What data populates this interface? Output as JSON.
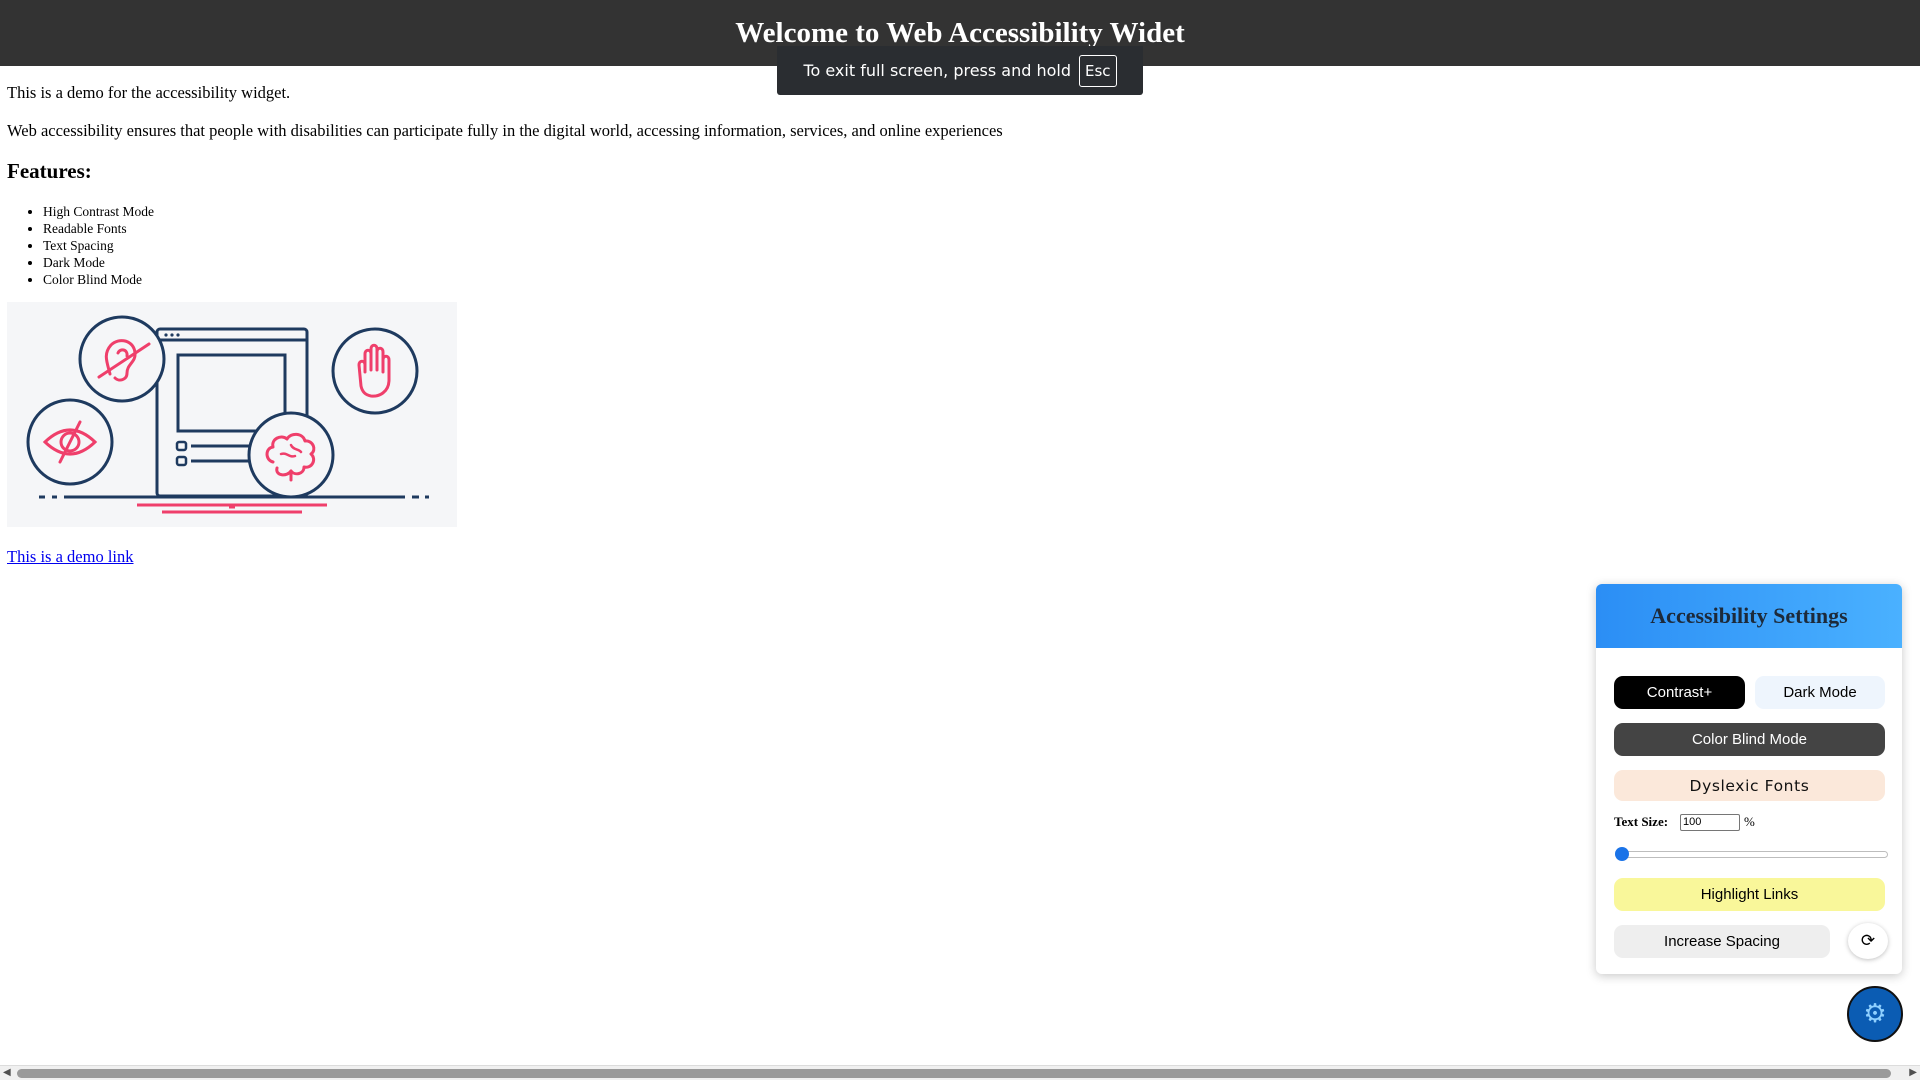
{
  "header": {
    "title": "Welcome to Web Accessibility Widet"
  },
  "fullscreen_notice": {
    "text": "To exit full screen, press and hold",
    "key": "Esc"
  },
  "main": {
    "intro": "This is a demo for the accessibility widget.",
    "description": "Web accessibility ensures that people with disabilities can participate fully in the digital world, accessing information, services, and online experiences",
    "features_heading": "Features:",
    "features": [
      "High Contrast Mode",
      "Readable Fonts",
      "Text Spacing",
      "Dark Mode",
      "Color Blind Mode"
    ],
    "illustration_icons": [
      "hearing-impaired-icon",
      "hand-icon",
      "visually-impaired-icon",
      "brain-icon",
      "browser-window-icon"
    ],
    "demo_link": "This is a demo link"
  },
  "panel": {
    "title": "Accessibility Settings",
    "contrast_label": "Contrast+",
    "dark_mode_label": "Dark Mode",
    "color_blind_label": "Color Blind Mode",
    "dyslexic_label": "Dyslexic Fonts",
    "text_size_label": "Text Size:",
    "text_size_value": "100",
    "text_size_unit": "%",
    "text_size_slider_fraction": 0.0,
    "highlight_links_label": "Highlight Links",
    "increase_spacing_label": "Increase Spacing",
    "reset_icon": "reset-icon"
  },
  "fab": {
    "icon": "gear-icon"
  },
  "colors": {
    "header_bg": "#333333",
    "panel_header_gradient": [
      "#2b8ef5",
      "#4ab1ff"
    ],
    "illustration_navy": "#1e3a5f",
    "illustration_pink": "#ef3f6b",
    "fab_bg": "#0b5cb3"
  }
}
